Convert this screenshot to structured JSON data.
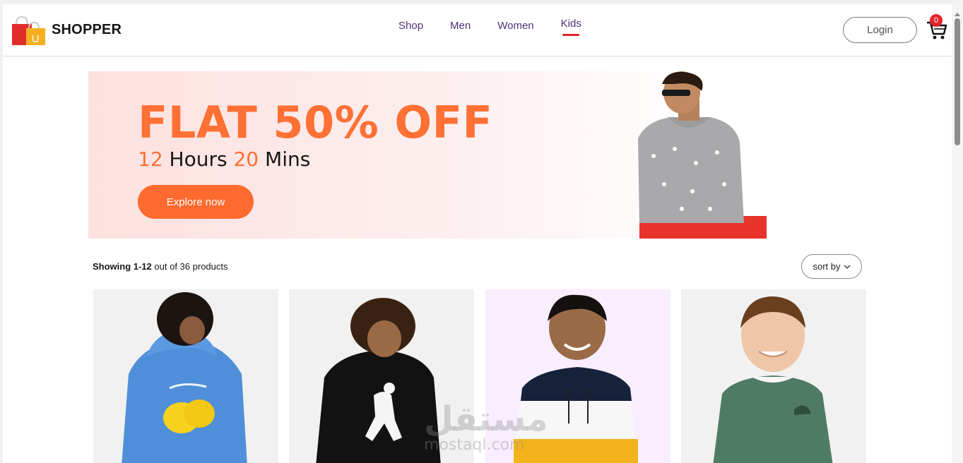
{
  "brand": {
    "name": "SHOPPER",
    "logo_letter": "U"
  },
  "nav": {
    "items": [
      {
        "label": "Shop",
        "active": false
      },
      {
        "label": "Men",
        "active": false
      },
      {
        "label": "Women",
        "active": false
      },
      {
        "label": "Kids",
        "active": true
      }
    ]
  },
  "header": {
    "login_label": "Login",
    "cart_count": "0"
  },
  "hero": {
    "title": "FLAT 50% OFF",
    "hours_value": "12",
    "hours_label": "Hours",
    "mins_value": "20",
    "mins_label": "Mins",
    "cta_label": "Explore now"
  },
  "listing": {
    "showing_range": "Showing 1-12",
    "showing_rest": "out of 36 products",
    "sort_label": "sort by"
  },
  "products": [
    {
      "image": "kid-blue-hoodie-lemon"
    },
    {
      "image": "kid-black-hoodie-footballer"
    },
    {
      "image": "kid-colorblock-hoodie"
    },
    {
      "image": "kid-green-sweatshirt-dino"
    }
  ],
  "watermark": {
    "arabic": "مستقل",
    "latin": "mostaql.com"
  },
  "colors": {
    "accent": "#ff6a2e",
    "nav_text": "#52307c",
    "badge": "#e3242b"
  }
}
